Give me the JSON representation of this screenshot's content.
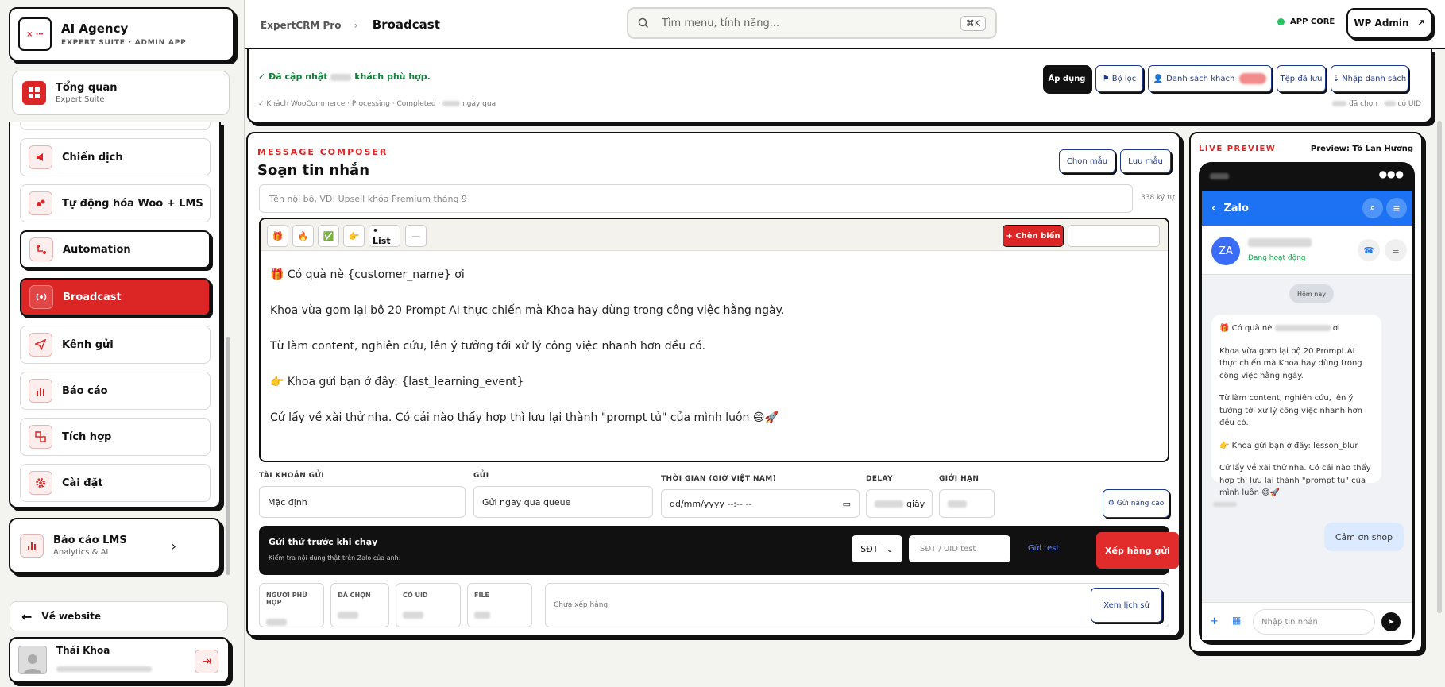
{
  "brand": {
    "title": "AI Agency",
    "subtitle": "EXPERT SUITE · ADMIN APP"
  },
  "overview": {
    "title": "Tổng quan",
    "subtitle": "Expert Suite"
  },
  "nav": [
    {
      "label": "Chiến dịch",
      "icon": "megaphone-icon"
    },
    {
      "label": "Tự động hóa Woo + LMS",
      "icon": "robot-icon"
    },
    {
      "label": "Automation",
      "icon": "flow-icon"
    },
    {
      "label": "Broadcast",
      "icon": "broadcast-icon"
    },
    {
      "label": "Kênh gửi",
      "icon": "send-icon"
    },
    {
      "label": "Báo cáo",
      "icon": "bar-chart-icon"
    },
    {
      "label": "Tích hợp",
      "icon": "integration-icon"
    },
    {
      "label": "Cài đặt",
      "icon": "gear-icon"
    }
  ],
  "lms": {
    "title": "Báo cáo LMS",
    "subtitle": "Analytics & AI"
  },
  "back_label": "Về website",
  "user": {
    "name": "Thái Khoa"
  },
  "header": {
    "crumb_parent": "ExpertCRM Pro",
    "crumb_current": "Broadcast",
    "search_placeholder": "Tìm menu, tính năng...",
    "shortcut": "⌘K",
    "core_label": "APP CORE",
    "wp_label": "WP Admin"
  },
  "filter": {
    "msg_a": "✓ Đã cập nhật",
    "msg_b": "khách phù hợp.",
    "sub_a": "✓ Khách WooCommerce · Processing · Completed ·",
    "sub_b": "ngày qua",
    "right_a": "đã chọn ·",
    "right_b": "có UID",
    "buttons": [
      "Áp dụng",
      "Bộ lọc",
      "Danh sách khách",
      "Tệp đã lưu",
      "Nhập danh sách"
    ]
  },
  "composer": {
    "kicker": "MESSAGE COMPOSER",
    "title": "Soạn tin nhắn",
    "choose_template": "Chọn mẫu",
    "save_template": "Lưu mẫu",
    "name_placeholder": "Tên nội bộ, VD: Upsell khóa Premium tháng 9",
    "char_count": "338 ký tự",
    "toolbar": {
      "list": "• List",
      "divider": "—",
      "insert_var": "+ Chèn biến"
    },
    "lines": [
      "🎁 Có quà nè {customer_name} ơi",
      "Khoa vừa gom lại bộ 20 Prompt AI thực chiến mà Khoa hay dùng trong công việc hằng ngày.",
      "Từ làm content, nghiên cứu, lên ý tưởng tới xử lý công việc nhanh hơn đều có.",
      "👉 Khoa gửi bạn ở đây: {last_learning_event}",
      "Cứ lấy về xài thử nha. Có cái nào thấy hợp thì lưu lại thành \"prompt tủ\" của mình luôn 😄🚀"
    ],
    "fields": {
      "account_label": "TÀI KHOẢN GỬI",
      "account_value": "Mặc định",
      "send_label": "GỬI",
      "send_value": "Gửi ngay qua queue",
      "time_label": "THỜI GIAN (GIỜ VIỆT NAM)",
      "time_value": "dd/mm/yyyy --:-- --",
      "delay_label": "DELAY",
      "delay_unit": "giây",
      "limit_label": "GIỚI HẠN",
      "advanced": "⚙ Gửi nâng cao"
    },
    "test": {
      "title": "Gửi thử trước khi chạy",
      "subtitle": "Kiểm tra nội dung thật trên Zalo của anh.",
      "channel": "SĐT",
      "uid_placeholder": "SĐT / UID test",
      "send_test": "Gửi test",
      "queue": "Xếp hàng gửi"
    },
    "stats": [
      "NGƯỜI PHÙ HỢP",
      "ĐÃ CHỌN",
      "CÓ UID",
      "FILE"
    ],
    "status": "Chưa xếp hàng.",
    "history": "Xem lịch sử"
  },
  "preview": {
    "kicker": "LIVE PREVIEW",
    "name": "Preview: Tô Lan Hương",
    "app": "Zalo",
    "initials": "ZA",
    "online": "Đang hoạt động",
    "day": "Hôm nay",
    "bubble": [
      "🎁 Có quà nè",
      "Khoa vừa gom lại bộ 20 Prompt AI thực chiến mà Khoa hay dùng trong công việc hằng ngày.",
      "Từ làm content, nghiên cứu, lên ý tưởng tới xử lý công việc nhanh hơn đều có.",
      "👉 Khoa gửi bạn ở đây: lesson_blur",
      "Cứ lấy về xài thử nha. Có cái nào thấy hợp thì lưu lại thành \"prompt tủ\" của mình luôn 😄🚀"
    ],
    "bubble_suffix": "ơi",
    "reply": "Cảm ơn shop",
    "input_placeholder": "Nhập tin nhắn"
  },
  "colors": {
    "accent": "#dc2626",
    "blue": "#1d72f3",
    "ink": "#111111"
  }
}
